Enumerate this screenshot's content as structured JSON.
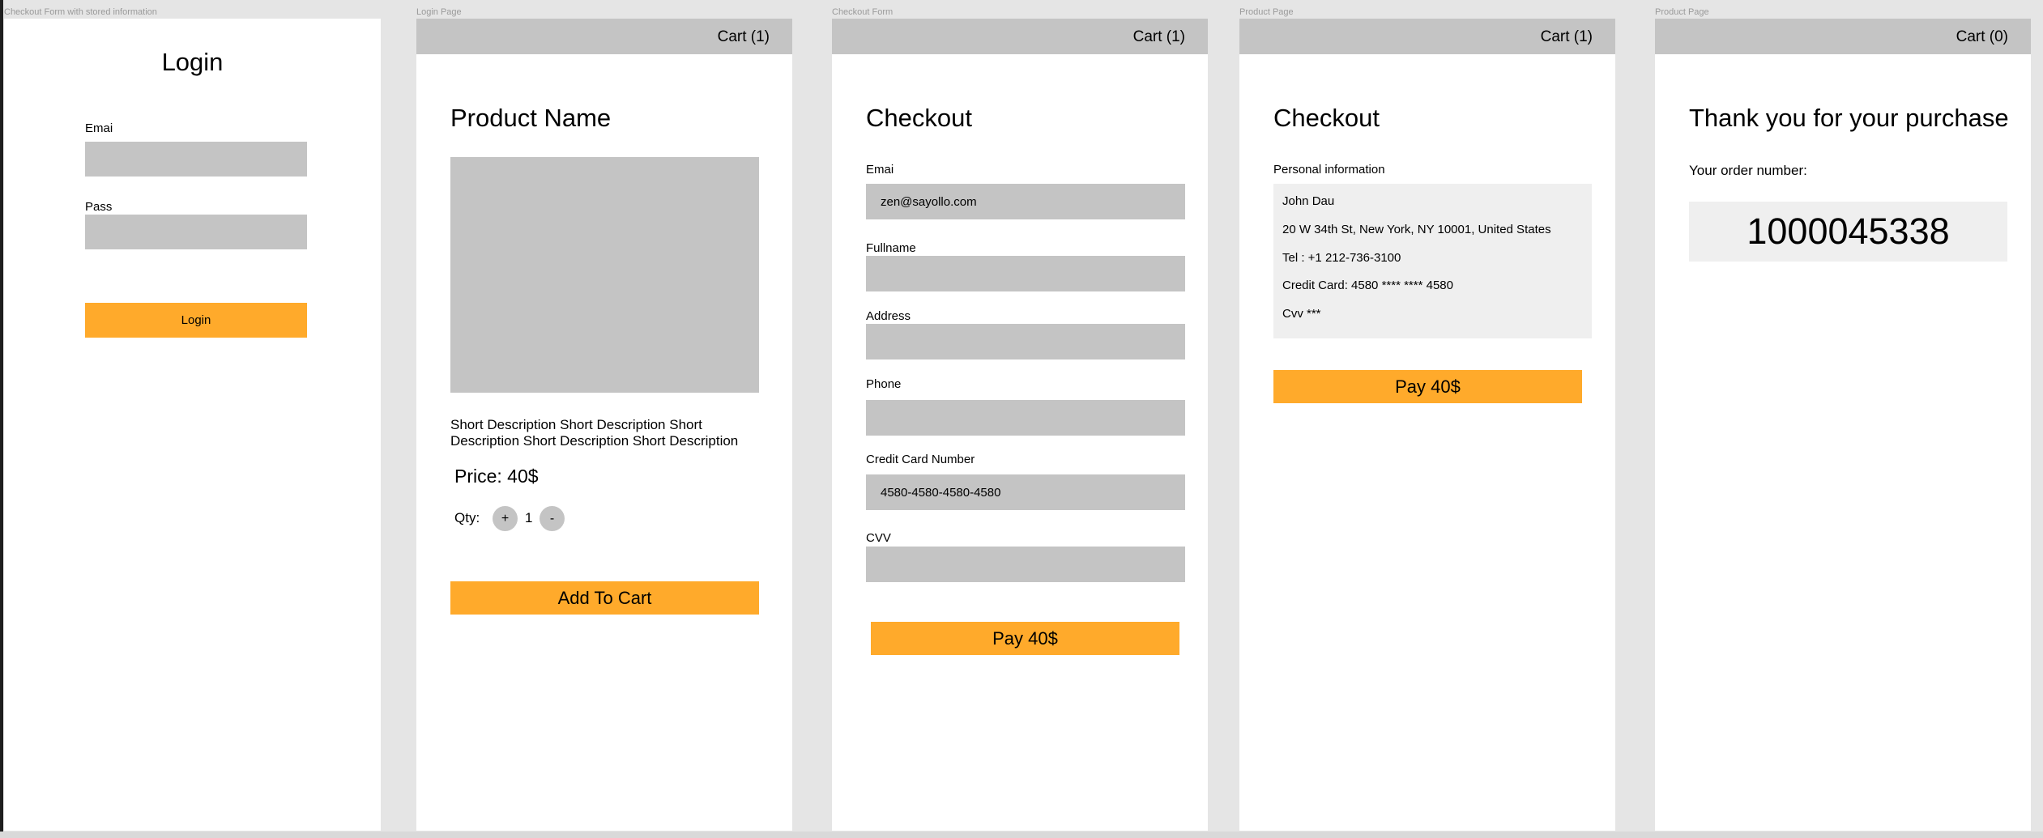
{
  "frames": {
    "login": {
      "caption": "Checkout Form with stored information",
      "title": "Login",
      "email_label": "Emai",
      "pass_label": "Pass",
      "button": "Login"
    },
    "product": {
      "caption": "Login Page",
      "cart": "Cart (1)",
      "title": "Product Name",
      "description": "Short Description Short Description Short Description Short Description Short Description",
      "price": "Price: 40$",
      "qty_label": "Qty:",
      "plus": "+",
      "qty_value": "1",
      "minus": "-",
      "button": "Add To Cart"
    },
    "checkout": {
      "caption": "Checkout Form",
      "cart": "Cart (1)",
      "title": "Checkout",
      "email_label": "Emai",
      "email_value": "zen@sayollo.com",
      "fullname_label": "Fullname",
      "address_label": "Address",
      "phone_label": "Phone",
      "card_label": "Credit Card Number",
      "card_value": "4580-4580-4580-4580",
      "cvv_label": "CVV",
      "button": "Pay 40$"
    },
    "checkout_stored": {
      "caption": "Product Page",
      "cart": "Cart (1)",
      "title": "Checkout",
      "section_label": "Personal information",
      "lines": [
        "John Dau",
        "20 W 34th St, New York, NY 10001, United States",
        "Tel : +1 212-736-3100",
        "Credit Card: 4580 **** **** 4580",
        "Cvv ***"
      ],
      "button": "Pay 40$"
    },
    "thankyou": {
      "caption": "Product Page",
      "cart": "Cart (0)",
      "title": "Thank you for your purchase",
      "order_label": "Your order number:",
      "order_number": "1000045338"
    }
  },
  "colors": {
    "canvas": "#e5e5e5",
    "frame": "#ffffff",
    "placeholder_gray": "#c4c4c4",
    "light_panel": "#efefef",
    "accent_orange": "#ffaa2b"
  }
}
